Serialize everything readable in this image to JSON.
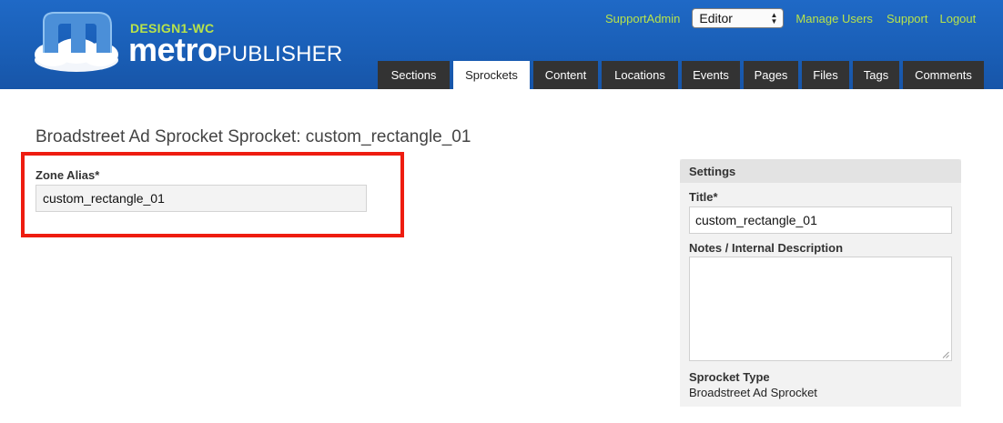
{
  "header": {
    "site_name": "DESIGN1-WC",
    "brand_metro": "metro",
    "brand_publisher": "PUBLISHER",
    "logo_letter": "m"
  },
  "top_links": {
    "support_admin": "SupportAdmin",
    "role_selected": "Editor",
    "manage_users": "Manage Users",
    "support": "Support",
    "logout": "Logout"
  },
  "tabs": [
    {
      "label": "Sections",
      "active": false
    },
    {
      "label": "Sprockets",
      "active": true
    },
    {
      "label": "Content",
      "active": false
    },
    {
      "label": "Locations",
      "active": false
    },
    {
      "label": "Events",
      "active": false
    },
    {
      "label": "Pages",
      "active": false
    },
    {
      "label": "Files",
      "active": false
    },
    {
      "label": "Tags",
      "active": false
    },
    {
      "label": "Comments",
      "active": false
    }
  ],
  "main": {
    "page_title": "Broadstreet Ad Sprocket Sprocket: custom_rectangle_01",
    "zone_alias_label": "Zone Alias*",
    "zone_alias_value": "custom_rectangle_01"
  },
  "settings": {
    "header": "Settings",
    "title_label": "Title*",
    "title_value": "custom_rectangle_01",
    "notes_label": "Notes / Internal Description",
    "notes_value": "",
    "type_label": "Sprocket Type",
    "type_value": "Broadstreet Ad Sprocket"
  },
  "colors": {
    "header_blue": "#1a5fb7",
    "link_green": "#b8e34a",
    "tab_dark": "#333333",
    "highlight_red": "#ee1c10"
  }
}
